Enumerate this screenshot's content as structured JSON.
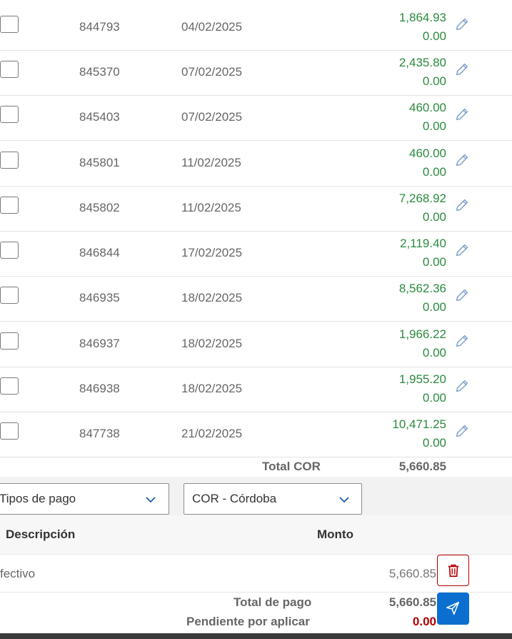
{
  "invoices": [
    {
      "id": "844793",
      "date": "04/02/2025",
      "amount": "1,864.93",
      "applied": "0.00"
    },
    {
      "id": "845370",
      "date": "07/02/2025",
      "amount": "2,435.80",
      "applied": "0.00"
    },
    {
      "id": "845403",
      "date": "07/02/2025",
      "amount": "460.00",
      "applied": "0.00"
    },
    {
      "id": "845801",
      "date": "11/02/2025",
      "amount": "460.00",
      "applied": "0.00"
    },
    {
      "id": "845802",
      "date": "11/02/2025",
      "amount": "7,268.92",
      "applied": "0.00"
    },
    {
      "id": "846844",
      "date": "17/02/2025",
      "amount": "2,119.40",
      "applied": "0.00"
    },
    {
      "id": "846935",
      "date": "18/02/2025",
      "amount": "8,562.36",
      "applied": "0.00"
    },
    {
      "id": "846937",
      "date": "18/02/2025",
      "amount": "1,966.22",
      "applied": "0.00"
    },
    {
      "id": "846938",
      "date": "18/02/2025",
      "amount": "1,955.20",
      "applied": "0.00"
    },
    {
      "id": "847738",
      "date": "21/02/2025",
      "amount": "10,471.25",
      "applied": "0.00"
    }
  ],
  "total": {
    "label": "Total COR",
    "value": "5,660.85"
  },
  "filters": {
    "payment_type": "Tipos de pago",
    "currency": "COR - Córdoba"
  },
  "payments_table": {
    "headers": {
      "description": "Descripción",
      "amount": "Monto"
    },
    "rows": [
      {
        "description": "fectivo",
        "amount": "5,660.85"
      }
    ]
  },
  "summary": {
    "total_payment_label": "Total de pago",
    "total_payment_value": "5,660.85",
    "pending_label": "Pendiente por aplicar",
    "pending_value": "0.00"
  },
  "colors": {
    "amount": "#2b8a3e",
    "pending": "#b30000",
    "delete": "#b30000",
    "send": "#0b6fd0",
    "edit_icon": "#7a9fc7"
  },
  "icons": {
    "edit": "pencil-icon",
    "delete": "trash-icon",
    "send": "paper-plane-icon",
    "dropdown": "chevron-down-icon"
  }
}
